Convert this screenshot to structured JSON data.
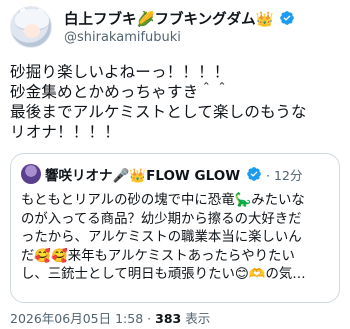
{
  "author": {
    "name": "白上フブキ🌽フブキングダム👑",
    "handle": "@shirakamifubuki",
    "badge": "verified"
  },
  "tweet": {
    "lines": [
      "砂掘り楽しいよねーっ！！！！",
      "砂金集めとかめっちゃすき＾＾",
      "最後までアルケミストとして楽しのもうな",
      "リオナ！！！！"
    ]
  },
  "quote": {
    "name": "響咲リオナ🎤👑FLOW GLOW",
    "meta": "· 12分",
    "lines": [
      "もともとリアルの砂の塊で中に恐竜🦕みたいな",
      "のが入ってる商品？幼少期から擦るの大好きだ",
      "ったから、アルケミストの職業本当に楽しいん",
      "だ🥰🥰来年もアルケミストあったらやりたい",
      "し、三銃士として明日も頑張りたい😊🫶の気…"
    ]
  },
  "footer": {
    "datetime": "2026年06月05日 1:58",
    "separator": "·",
    "views_count": "383",
    "views_label": "表示"
  }
}
